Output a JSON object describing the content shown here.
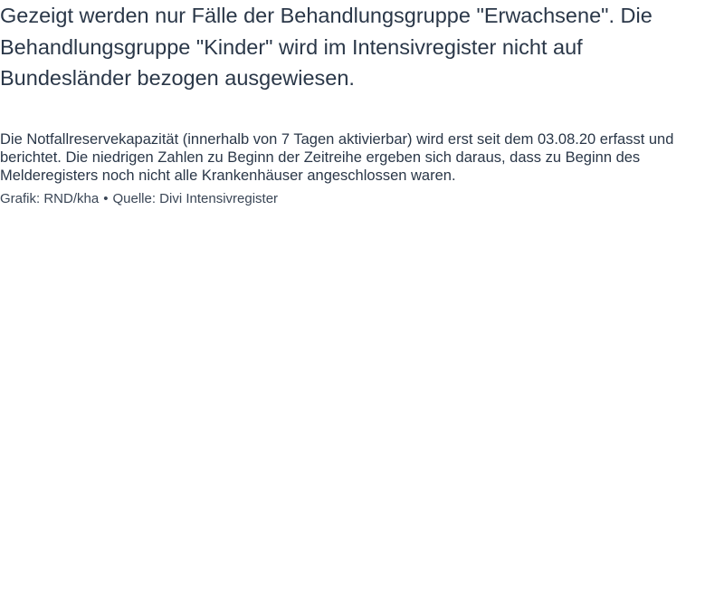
{
  "intro": "Gezeigt werden nur Fälle der Behandlungsgruppe \"Erwachsene\". Die Behandlungsgruppe \"Kinder\" wird im Intensivregister nicht auf Bundesländer bezogen ausgewiesen.",
  "note": "Die Notfallreservekapazität (innerhalb von 7 Tagen aktivierbar) wird erst seit dem 03.08.20 erfasst und berichtet. Die niedrigen Zahlen zu Beginn der Zeitreihe ergeben sich daraus, dass zu Beginn des Melderegisters noch nicht alle Krankenhäuser angeschlossen waren.",
  "credits": {
    "graphic": "Grafik: RND/kha",
    "separator": "•",
    "source": "Quelle: Divi Intensivregister"
  }
}
